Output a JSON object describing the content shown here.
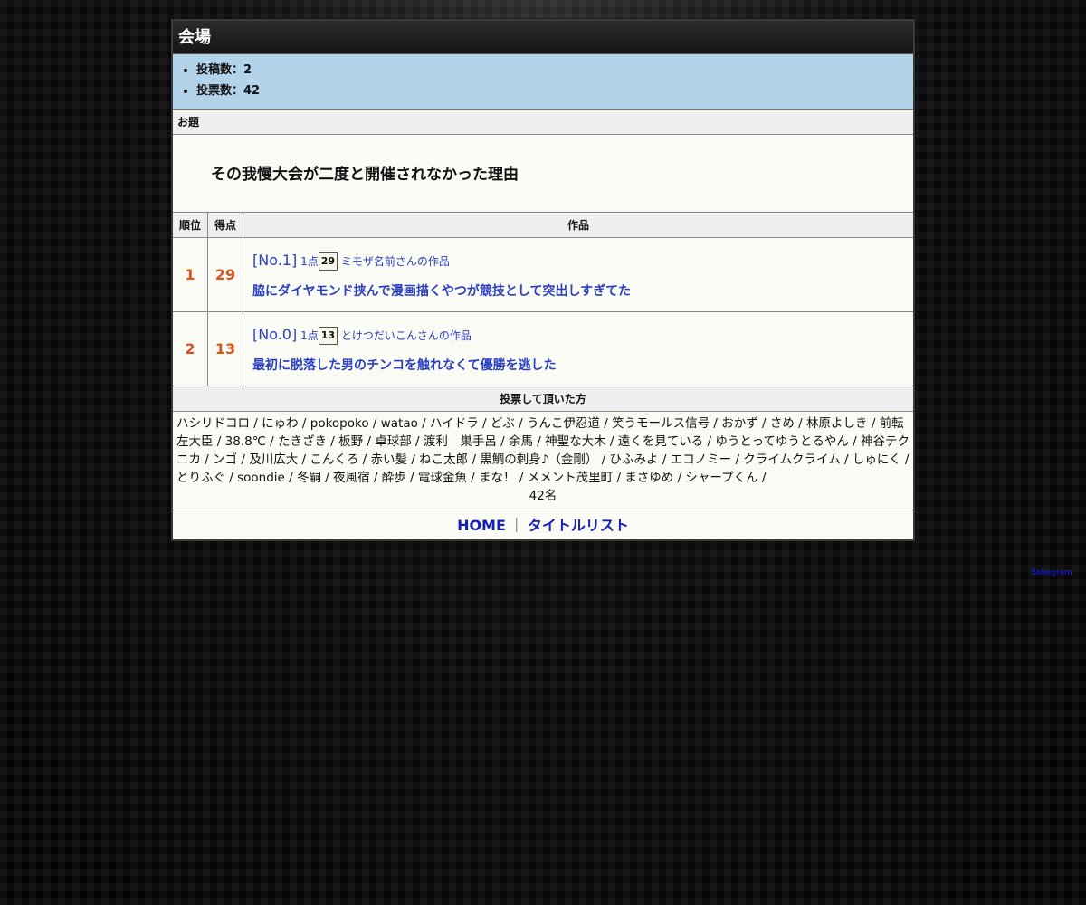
{
  "header": {
    "title": "会場"
  },
  "stats": [
    {
      "label": "投稿数：2"
    },
    {
      "label": "投票数：42"
    }
  ],
  "topic": {
    "heading": "お題",
    "text": "その我慢大会が二度と開催されなかった理由"
  },
  "table": {
    "headers": {
      "rank": "順位",
      "score": "得点",
      "work": "作品"
    },
    "rows": [
      {
        "rank": "1",
        "score": "29",
        "no": "[No.1]",
        "per_vote": "1点",
        "votes": "29",
        "author": "ミモザ名前さんの作品",
        "title": "脇にダイヤモンド挟んで漫画描くやつが競技として突出しすぎてた"
      },
      {
        "rank": "2",
        "score": "13",
        "no": "[No.0]",
        "per_vote": "1点",
        "votes": "13",
        "author": "とけつだいこんさんの作品",
        "title": "最初に脱落した男のチンコを触れなくて優勝を逃した"
      }
    ]
  },
  "voters": {
    "heading": "投票して頂いた方",
    "list": "ハシリドコロ / にゅわ / pokopoko / watao / ハイドラ / どぶ / うんこ伊忍道 / 笑うモールス信号 / おかず / さめ / 林原よしき / 前転左大臣 / 38.8℃ / たきざき / 板野 / 卓球部 / 渡利　巣手呂 / 余馬 / 神聖な大木 / 遠くを見ている / ゆうとってゆうとるやん / 神谷テクニカ / ンゴ / 及川広大 / こんくろ / 赤い髪 / ねこ太郎 / 黒鯛の刺身♪（金剛） / ひふみよ / エコノミー / クライムクライム / しゅにく / とりふぐ / soondie / 冬嗣 / 夜風宿 / 酔歩 / 電球金魚 / まな！ / メメント茂里町 / まさゆめ / シャープくん /",
    "count": "42名"
  },
  "footer": {
    "home": "HOME",
    "separator": "｜",
    "title_list": "タイトルリスト"
  },
  "corner_link": "Bokegram"
}
